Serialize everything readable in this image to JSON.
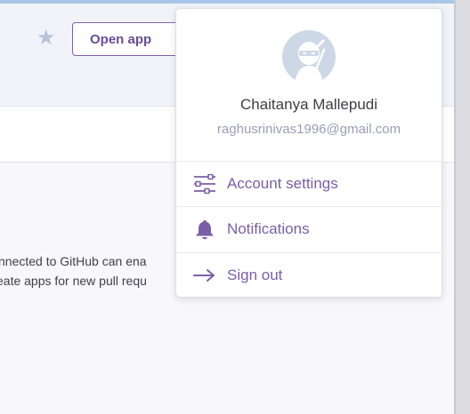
{
  "header": {
    "favorite_icon": "star-icon",
    "open_app_label": "Open app"
  },
  "content": {
    "text_lines": [
      "nnected to GitHub can ena",
      "eate apps for new pull requ"
    ]
  },
  "account_menu": {
    "avatar_icon": "ninja-avatar-icon",
    "user_name": "Chaitanya Mallepudi",
    "email": "raghusrinivas1996@gmail.com",
    "items": [
      {
        "label": "Account settings",
        "icon": "sliders-icon"
      },
      {
        "label": "Notifications",
        "icon": "bell-icon"
      },
      {
        "label": "Sign out",
        "icon": "arrow-right-icon"
      }
    ]
  },
  "colors": {
    "accent": "#7a5ea8",
    "email_text": "#9a9eb6",
    "avatar_bg": "#cdd8e6"
  }
}
